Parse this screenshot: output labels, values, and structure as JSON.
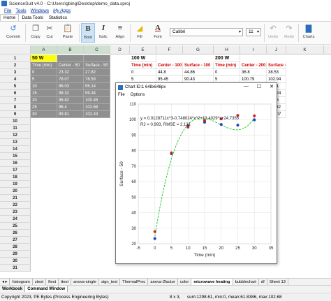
{
  "titlebar": {
    "title": "ScienceSuit v4.0 - C:\\Users\\gbing\\Desktop\\demo_data.sproj"
  },
  "menubar": {
    "items": [
      "File",
      "Tools",
      "Windows",
      "My Apps"
    ]
  },
  "ribbon": {
    "tabs": [
      "Home",
      "Data Tools",
      "Statistics"
    ],
    "buttons": {
      "commit": "Commit",
      "copy": "Copy",
      "cut": "Cut",
      "paste": "Paste",
      "bold": "Bold",
      "italic": "Italic",
      "align": "Align",
      "fill": "Fill",
      "font": "Font",
      "undo": "Undo",
      "redo": "Redo",
      "charts": "Charts"
    },
    "font_name": "Calibri",
    "font_size": "11"
  },
  "sheet": {
    "columns": [
      "A",
      "B",
      "C",
      "D",
      "E",
      "F",
      "G",
      "H",
      "I",
      "J",
      "K"
    ],
    "rows": [
      "1",
      "2",
      "3",
      "4",
      "5",
      "6",
      "7",
      "8",
      "9",
      "10",
      "11",
      "12",
      "13",
      "14",
      "15",
      "16",
      "17",
      "18",
      "19",
      "20",
      "21",
      "22",
      "23",
      "24",
      "25",
      "26",
      "27",
      "28",
      "29",
      "30",
      "31"
    ],
    "block1": {
      "title": "50 W",
      "headers": [
        "Time (min)",
        "Center - 50",
        "Surface - 50"
      ],
      "data": [
        [
          "0",
          "23.32",
          "27.82"
        ],
        [
          "5",
          "78.07",
          "78.53"
        ],
        [
          "10",
          "96.03",
          "95.14"
        ],
        [
          "15",
          "98.32",
          "99.34"
        ],
        [
          "20",
          "96.82",
          "100.45"
        ],
        [
          "25",
          "96.4",
          "102.68"
        ],
        [
          "30",
          "99.81",
          "102.43"
        ]
      ]
    },
    "block2": {
      "title": "100 W",
      "headers": [
        "Time (min)",
        "Center - 100",
        "Surface - 100"
      ],
      "data": [
        [
          "0",
          "44.8",
          "44.86"
        ],
        [
          "5",
          "95.45",
          "90.43"
        ]
      ]
    },
    "block3": {
      "title": "200 W",
      "headers": [
        "Time (min)",
        "Center - 200",
        "Surface - 200"
      ],
      "data": [
        [
          "0",
          "36.8",
          "38.53"
        ],
        [
          "5",
          "100.79",
          "102.94"
        ],
        [
          "",
          "",
          "104.1"
        ],
        [
          "",
          "",
          "105.24"
        ],
        [
          "",
          "",
          "106.5"
        ],
        [
          "",
          "",
          "116.32"
        ],
        [
          "",
          "",
          "138.07"
        ]
      ]
    }
  },
  "chart_window": {
    "title": "Chart ID:1 648x648px",
    "menu": [
      "File",
      "Options"
    ],
    "controls": [
      "—",
      "☐",
      "✕"
    ]
  },
  "chart_data": {
    "type": "scatter",
    "title": "",
    "xlabel": "Time (min)",
    "ylabel": "Surface - 50",
    "xlim": [
      -5,
      35
    ],
    "ylim": [
      20,
      110
    ],
    "xticks": [
      "-5",
      "0",
      "5",
      "10",
      "15",
      "20",
      "25",
      "30",
      "35"
    ],
    "yticks": [
      "20",
      "30",
      "40",
      "50",
      "60",
      "70",
      "80",
      "90",
      "100",
      "110"
    ],
    "equation": "y = 0.0128711x^3-0.748024*x^2+13.4029*x+24.7355",
    "fit_stats": "R2 = 0.993, RMSE = 2.131",
    "x": [
      0,
      5,
      10,
      15,
      20,
      25,
      30
    ],
    "series": [
      {
        "values": [
          23.32,
          78.07,
          96.03,
          98.32,
          96.82,
          96.4,
          99.81
        ],
        "color": "#1f3fc0"
      },
      {
        "values": [
          27.82,
          78.53,
          95.14,
          99.34,
          100.45,
          102.68,
          102.43
        ],
        "color": "#cc2222"
      }
    ],
    "fit_coefficients": [
      0.0128711,
      -0.748024,
      13.4029,
      24.7355
    ],
    "fit_color": "#2ecc2e",
    "grid": true
  },
  "sheet_tabs": {
    "items": [
      "histogram",
      "ztest",
      "ftest",
      "ttest",
      "anova-single",
      "sign_test",
      "ThermalProc",
      "anova-2factor",
      "color",
      "microwave heating",
      "bubblechart",
      "df",
      "Sheet 13"
    ],
    "active": "microwave heating"
  },
  "bottom_tabs": {
    "items": [
      "Workbook",
      "Command Window"
    ],
    "active": "Command Window"
  },
  "status": {
    "copyright": "Copyright 2023, PE Bytes (Process Engineering Bytes)",
    "selection": "8 x 3,",
    "stats": "sum:1298.61,  min:0,   mean:61.8386,  max:102.68"
  }
}
